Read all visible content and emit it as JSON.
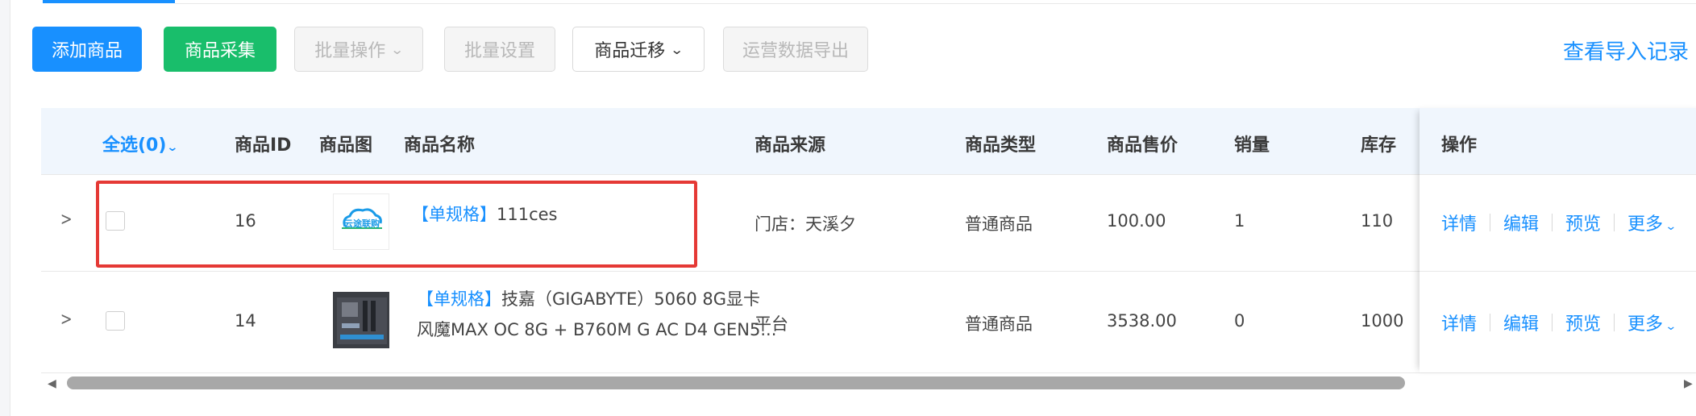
{
  "toolbar": {
    "add_product": "添加商品",
    "collect_product": "商品采集",
    "batch_operation": "批量操作",
    "batch_settings": "批量设置",
    "product_migration": "商品迁移",
    "export_operation_data": "运营数据导出",
    "view_import_records": "查看导入记录"
  },
  "table": {
    "headers": {
      "select_all": "全选(0)",
      "product_id": "商品ID",
      "product_image": "商品图",
      "product_name": "商品名称",
      "product_source": "商品来源",
      "product_type": "商品类型",
      "price": "商品售价",
      "sales": "销量",
      "stock": "库存",
      "operations": "操作"
    },
    "rows": [
      {
        "id": "16",
        "tag": "【单规格】",
        "name": "111ces",
        "thumb_text": "云途联购",
        "source": "门店：天溪夕",
        "type": "普通商品",
        "price": "100.00",
        "sales": "1",
        "stock": "110"
      },
      {
        "id": "14",
        "tag": "【单规格】",
        "name_line1": "技嘉（GIGABYTE）5060 8G显卡",
        "name_line2": "风魔MAX OC 8G + B760M G AC D4 GEN5...",
        "source": "平台",
        "type": "普通商品",
        "price": "3538.00",
        "sales": "0",
        "stock": "1000"
      }
    ],
    "actions": {
      "details": "详情",
      "edit": "编辑",
      "preview": "预览",
      "more": "更多"
    }
  },
  "colors": {
    "primary": "#1890ff",
    "green": "#19be6b",
    "highlight_box": "#e53935",
    "header_bg": "#f0f6fd"
  }
}
